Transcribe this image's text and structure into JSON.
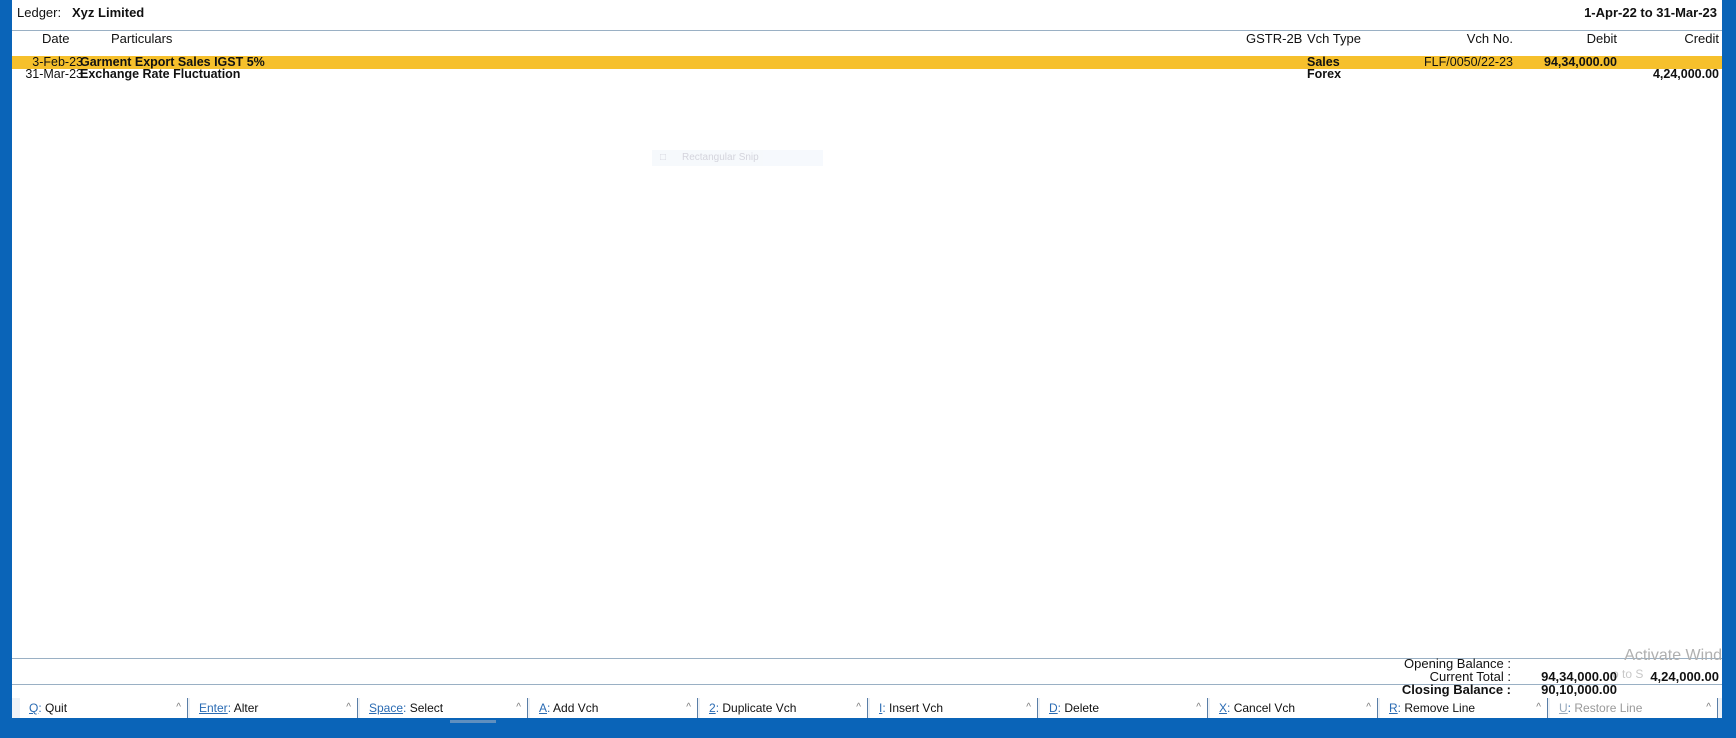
{
  "header": {
    "ledger_label": "Ledger:",
    "ledger_name": "Xyz Limited",
    "period": "1-Apr-22 to 31-Mar-23"
  },
  "columns": {
    "date": "Date",
    "particulars": "Particulars",
    "gstr": "GSTR-2B",
    "vch_type": "Vch Type",
    "vch_no": "Vch No.",
    "debit": "Debit",
    "credit": "Credit"
  },
  "rows": [
    {
      "date": "3-Feb-23",
      "particulars": "Garment Export Sales IGST 5%",
      "vch_type": "Sales",
      "vch_no": "FLF/0050/22-23",
      "debit": "94,34,000.00",
      "credit": "",
      "selected": true
    },
    {
      "date": "31-Mar-23",
      "particulars": "Exchange Rate Fluctuation",
      "vch_type": "Forex",
      "vch_no": "",
      "debit": "",
      "credit": "4,24,000.00",
      "selected": false
    }
  ],
  "overlay": {
    "snip_label": "Rectangular Snip"
  },
  "totals": {
    "opening_label": "Opening Balance :",
    "current_label": "Current Total :",
    "current_debit": "94,34,000.00",
    "current_credit": "4,24,000.00",
    "closing_label": "Closing Balance :",
    "closing_debit": "90,10,000.00"
  },
  "watermark": {
    "line1": "Activate Wind",
    "line2": "o to S"
  },
  "buttons": [
    {
      "key": "Q",
      "label": "Quit",
      "enabled": true
    },
    {
      "key": "Enter",
      "label": "Alter",
      "enabled": true
    },
    {
      "key": "Space",
      "label": "Select",
      "enabled": true
    },
    {
      "key": "A",
      "label": "Add Vch",
      "enabled": true
    },
    {
      "key": "2",
      "label": "Duplicate Vch",
      "enabled": true
    },
    {
      "key": "I",
      "label": "Insert Vch",
      "enabled": true
    },
    {
      "key": "D",
      "label": "Delete",
      "enabled": true
    },
    {
      "key": "X",
      "label": "Cancel Vch",
      "enabled": true
    },
    {
      "key": "R",
      "label": "Remove Line",
      "enabled": true
    },
    {
      "key": "U",
      "label": "Restore Line",
      "enabled": false
    }
  ],
  "colors": {
    "selected_row": "#f6c02c",
    "frame": "#0a64b8",
    "key_accent": "#2a6bb3"
  }
}
